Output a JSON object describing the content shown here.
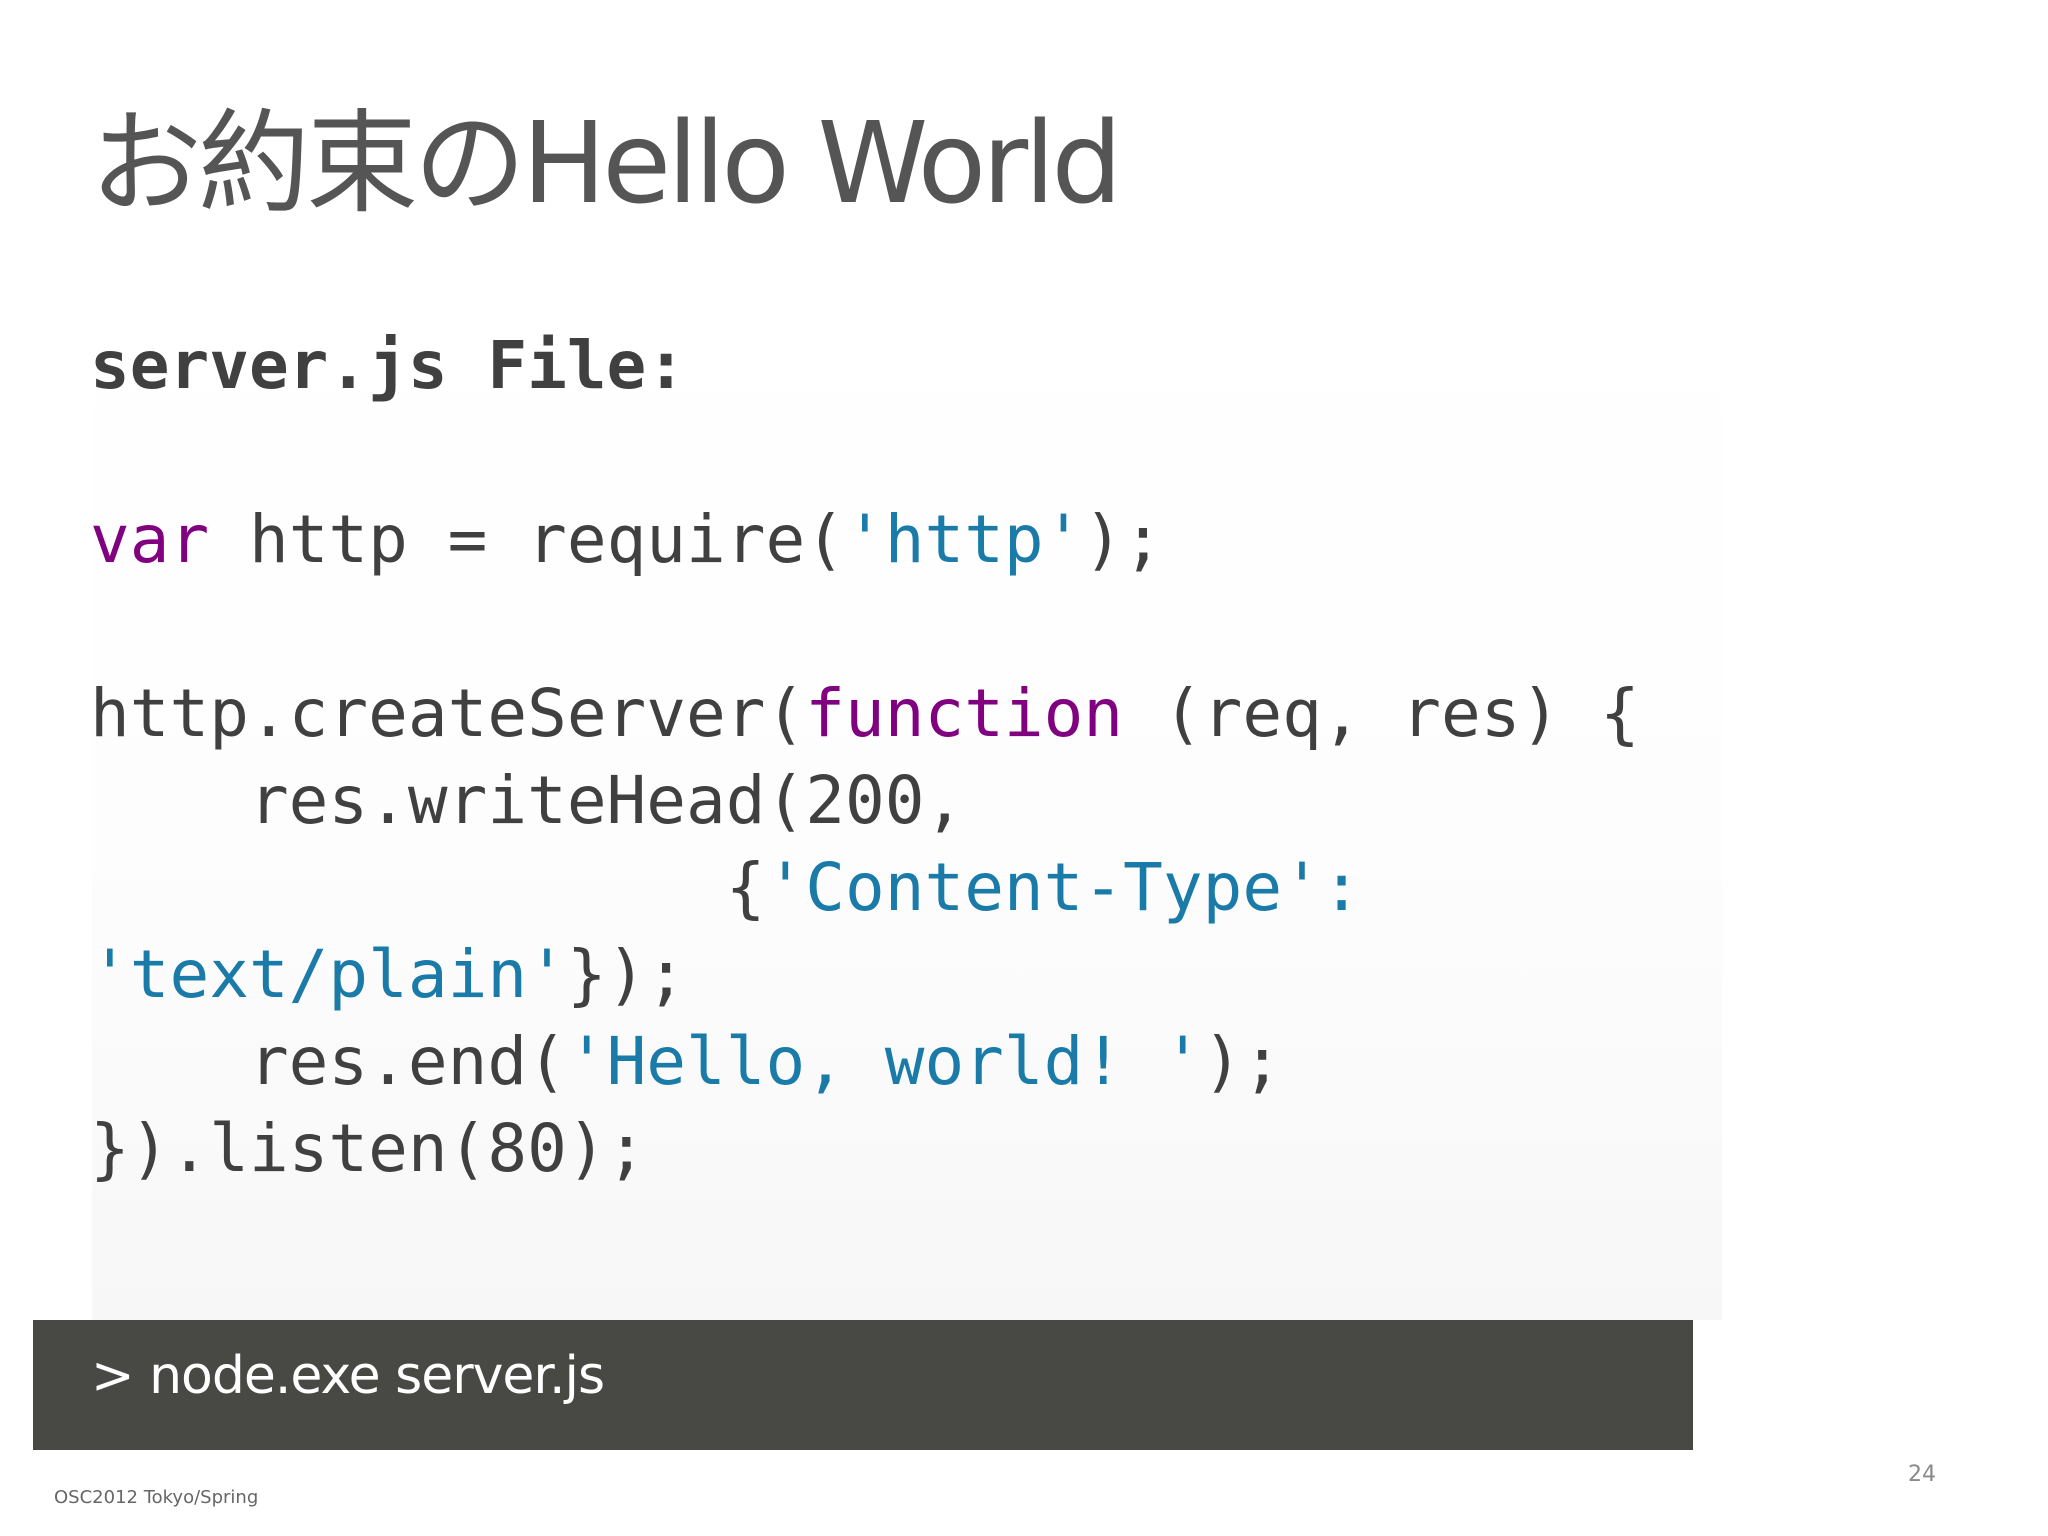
{
  "slide": {
    "title": "お約束のHello World",
    "code": {
      "heading": "server.js File:",
      "lines": [
        [
          {
            "type": "kw",
            "text": "var"
          },
          {
            "type": "plain",
            "text": " http = require("
          },
          {
            "type": "str",
            "text": "'http'"
          },
          {
            "type": "plain",
            "text": ");"
          }
        ],
        [],
        [
          {
            "type": "plain",
            "text": "http.createServer("
          },
          {
            "type": "kw",
            "text": "function"
          },
          {
            "type": "plain",
            "text": " (req, res) {"
          }
        ],
        [
          {
            "type": "plain",
            "text": "    res.writeHead(200,"
          }
        ],
        [
          {
            "type": "plain",
            "text": "                {"
          },
          {
            "type": "str",
            "text": "'Content-Type':"
          }
        ],
        [
          {
            "type": "str",
            "text": "'text/plain'"
          },
          {
            "type": "plain",
            "text": "});"
          }
        ],
        [
          {
            "type": "plain",
            "text": "    res.end("
          },
          {
            "type": "str",
            "text": "'Hello, world! '"
          },
          {
            "type": "plain",
            "text": ");"
          }
        ],
        [
          {
            "type": "plain",
            "text": "}).listen(80);"
          }
        ]
      ]
    },
    "terminal": {
      "command": "> node.exe server.js"
    },
    "footer": {
      "event": "OSC2012 Tokyo/Spring",
      "page_number": "24"
    },
    "colors": {
      "keyword": "#800080",
      "string": "#1a7aa8",
      "plain": "#404040",
      "terminal_background": "#484844",
      "terminal_text": "#ffffff"
    }
  }
}
